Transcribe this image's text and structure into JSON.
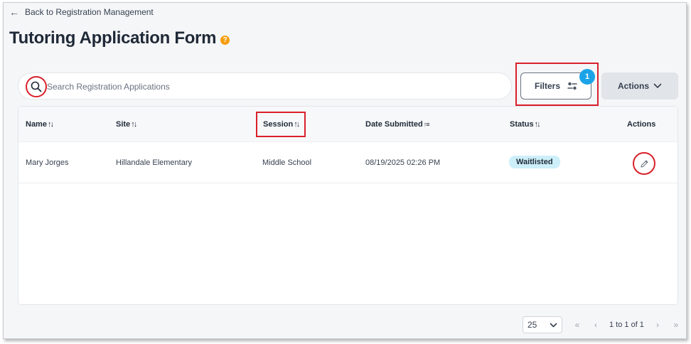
{
  "nav": {
    "back_label": "Back to Registration Management"
  },
  "page": {
    "title": "Tutoring Application Form"
  },
  "search": {
    "placeholder": "Search Registration Applications",
    "value": ""
  },
  "toolbar": {
    "filters_label": "Filters",
    "filters_count": "1",
    "actions_label": "Actions"
  },
  "table": {
    "columns": [
      "Name",
      "Site",
      "Session",
      "Date Submitted",
      "Status",
      "Actions"
    ],
    "rows": [
      {
        "name": "Mary Jorges",
        "site": "Hillandale Elementary",
        "session": "Middle School",
        "date_submitted": "08/19/2025 02:26 PM",
        "status": "Waitlisted"
      }
    ]
  },
  "pagination": {
    "page_size": "25",
    "range": "1 to 1 of 1"
  },
  "colors": {
    "highlight": "#d9202a",
    "badge": "#1ba3e8",
    "status_bg": "#cdeffa",
    "help": "#f59e0b"
  }
}
